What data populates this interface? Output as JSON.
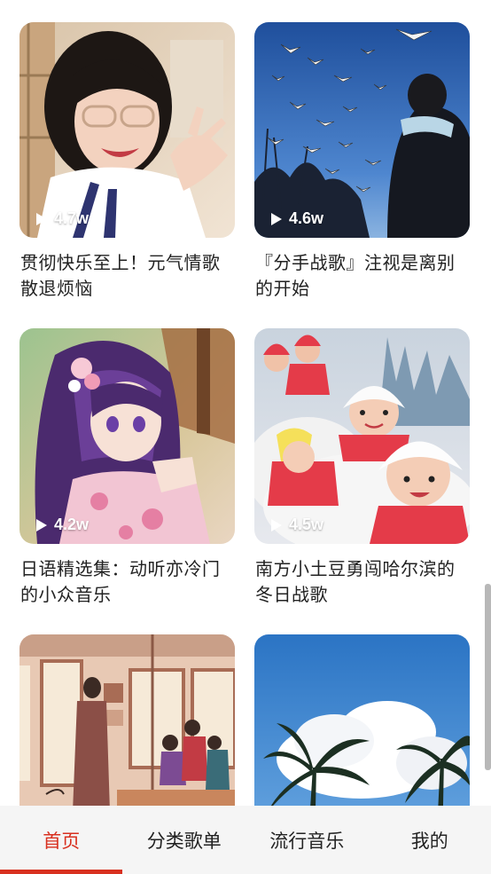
{
  "playlists": [
    {
      "title": "贯彻快乐至上！元气情歌散退烦恼",
      "plays": "4.7w",
      "image": "girl-with-glasses-photo"
    },
    {
      "title": "『分手战歌』注视是离别的开始",
      "plays": "4.6w",
      "image": "seagulls-blue-sky-photo"
    },
    {
      "title": "日语精选集：动听亦冷门的小众音乐",
      "plays": "4.2w",
      "image": "anime-girl-purple-hair-art"
    },
    {
      "title": "南方小土豆勇闯哈尔滨的冬日战歌",
      "plays": "4.5w",
      "image": "snow-kids-painting"
    },
    {
      "title": "",
      "plays": "",
      "image": "train-interior-illustration"
    },
    {
      "title": "",
      "plays": "",
      "image": "palm-trees-clouds-photo"
    }
  ],
  "tabbar": {
    "tabs": [
      {
        "label": "首页",
        "active": true
      },
      {
        "label": "分类歌单",
        "active": false
      },
      {
        "label": "流行音乐",
        "active": false
      },
      {
        "label": "我的",
        "active": false
      }
    ]
  },
  "colors": {
    "accent": "#d8301f",
    "text": "#222222",
    "tabbar_bg": "#f5f5f5"
  }
}
